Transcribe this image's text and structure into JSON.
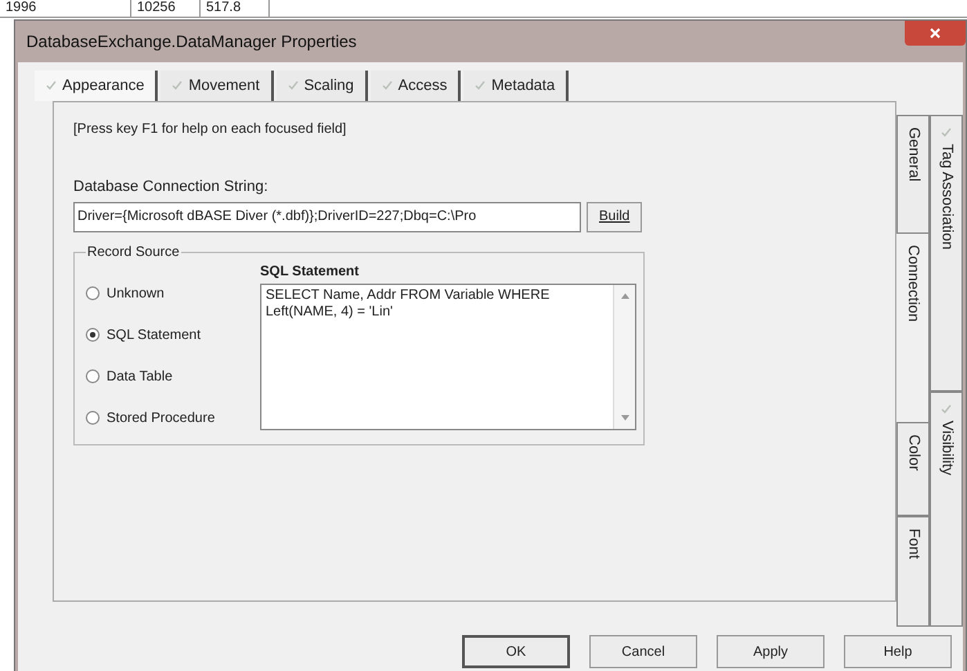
{
  "background_table": {
    "cells": [
      "1996",
      "10256",
      "517.8"
    ]
  },
  "window": {
    "title": "DatabaseExchange.DataManager Properties"
  },
  "tabs": [
    {
      "label": "Appearance",
      "selected": true,
      "checked": true
    },
    {
      "label": "Movement",
      "selected": false,
      "checked": true
    },
    {
      "label": "Scaling",
      "selected": false,
      "checked": true
    },
    {
      "label": "Access",
      "selected": false,
      "checked": true
    },
    {
      "label": "Metadata",
      "selected": false,
      "checked": true
    }
  ],
  "side_tabs_inner": [
    {
      "label": "General",
      "selected": false,
      "checked": false
    },
    {
      "label": "Connection",
      "selected": true,
      "checked": false
    },
    {
      "label": "Color",
      "selected": false,
      "checked": false
    },
    {
      "label": "Font",
      "selected": false,
      "checked": false
    }
  ],
  "side_tabs_outer": [
    {
      "label": "Tag Association",
      "selected": false,
      "checked": true
    },
    {
      "label": "Visibility",
      "selected": false,
      "checked": true
    }
  ],
  "hint": "[Press key F1 for help on each focused field]",
  "connection": {
    "label": "Database Connection String:",
    "value": "Driver={Microsoft dBASE Diver (*.dbf)};DriverID=227;Dbq=C:\\Pro",
    "button": "Build"
  },
  "record_source": {
    "legend": "Record Source",
    "options": [
      {
        "label": "Unknown",
        "selected": false
      },
      {
        "label": "SQL Statement",
        "selected": true
      },
      {
        "label": "Data Table",
        "selected": false
      },
      {
        "label": "Stored Procedure",
        "selected": false
      }
    ]
  },
  "sql": {
    "label": "SQL Statement",
    "value": "SELECT Name, Addr FROM Variable WHERE Left(NAME, 4) = 'Lin'"
  },
  "buttons": [
    {
      "label": "OK",
      "default": true
    },
    {
      "label": "Cancel",
      "default": false
    },
    {
      "label": "Apply",
      "default": false
    },
    {
      "label": "Help",
      "default": false
    }
  ]
}
